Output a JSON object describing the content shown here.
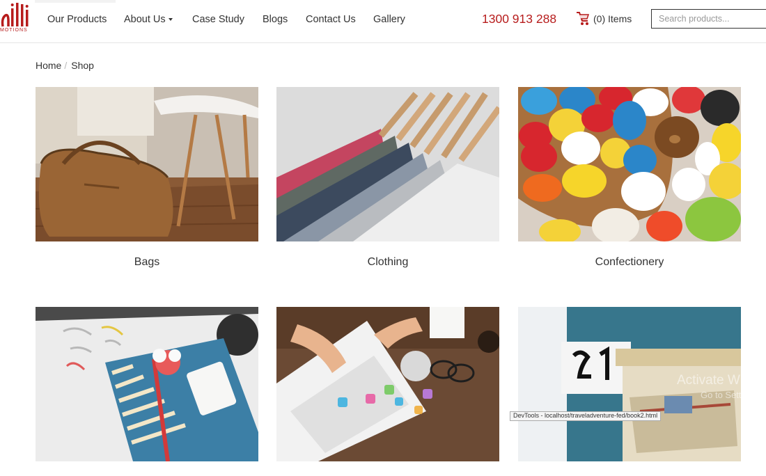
{
  "header": {
    "logo_subtext": "MOTIONS",
    "nav": [
      {
        "label": "Our Products",
        "dropdown": false
      },
      {
        "label": "About Us",
        "dropdown": true
      },
      {
        "label": "Case Study",
        "dropdown": false
      },
      {
        "label": "Blogs",
        "dropdown": false
      },
      {
        "label": "Contact Us",
        "dropdown": false
      },
      {
        "label": "Gallery",
        "dropdown": false
      }
    ],
    "phone": "1300 913 288",
    "cart_label": "(0) Items",
    "search_placeholder": "Search products..."
  },
  "breadcrumb": {
    "home": "Home",
    "separator": "/",
    "current": "Shop"
  },
  "categories": [
    {
      "label": "Bags",
      "image": "leather-bag-photo"
    },
    {
      "label": "Clothing",
      "image": "shirts-on-hangers-photo"
    },
    {
      "label": "Confectionery",
      "image": "candy-eggs-photo"
    },
    {
      "label": "",
      "image": "gift-wrap-photo"
    },
    {
      "label": "",
      "image": "laptop-desk-photo"
    },
    {
      "label": "",
      "image": "mailbox-photo"
    }
  ],
  "overlay": {
    "watermark_line1": "Activate Windows",
    "watermark_line2": "Go to Settings to activate",
    "status_bar": "DevTools - localhost/traveladventure-fed/book2.html"
  },
  "colors": {
    "brand": "#b71c1c",
    "text": "#333333",
    "border": "#e5e5e5"
  }
}
